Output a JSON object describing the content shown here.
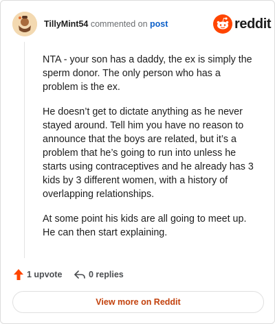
{
  "header": {
    "username": "TillyMint54",
    "commented_on": "commented on",
    "post_link": "post",
    "brand_name": "reddit",
    "brand_color": "#ff4500"
  },
  "comment": {
    "paragraphs": [
      "NTA - your son has a daddy, the ex is simply the sperm donor. The only person who has a problem is the ex.",
      "He doesn’t get to dictate anything as he never stayed around. Tell him you have no reason to announce that the boys are related, but it’s a problem that he’s going to run into unless he starts using contraceptives and he already has 3 kids by 3 different women, with a history of overlapping relationships.",
      "At some point his kids are all going to meet up. He can then start explaining."
    ]
  },
  "actions": {
    "upvote_label": "1 upvote",
    "upvote_icon": "upvote-arrow-icon",
    "upvote_color": "#ff4500",
    "replies_label": "0 replies",
    "replies_icon": "reply-arrow-icon"
  },
  "footer": {
    "view_more_label": "View more on Reddit",
    "view_more_color": "#c2410c"
  }
}
